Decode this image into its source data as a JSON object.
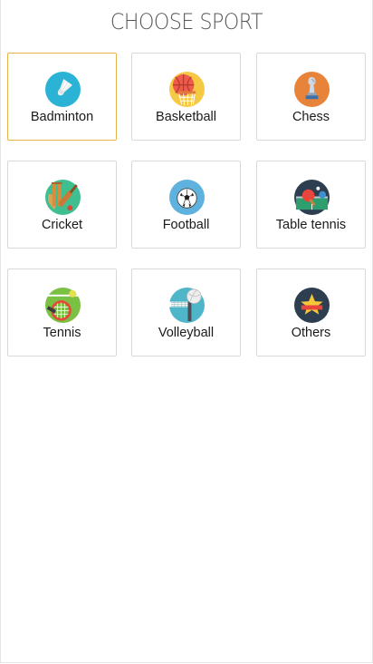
{
  "header": {
    "title": "CHOOSE SPORT"
  },
  "sports": [
    {
      "label": "Badminton",
      "icon": "shuttlecock-icon",
      "selected": true
    },
    {
      "label": "Basketball",
      "icon": "basketball-icon",
      "selected": false
    },
    {
      "label": "Chess",
      "icon": "chess-piece-icon",
      "selected": false
    },
    {
      "label": "Cricket",
      "icon": "cricket-bat-icon",
      "selected": false
    },
    {
      "label": "Football",
      "icon": "soccer-ball-icon",
      "selected": false
    },
    {
      "label": "Table tennis",
      "icon": "ping-pong-icon",
      "selected": false
    },
    {
      "label": "Tennis",
      "icon": "tennis-racket-icon",
      "selected": false
    },
    {
      "label": "Volleyball",
      "icon": "volleyball-icon",
      "selected": false
    },
    {
      "label": "Others",
      "icon": "star-icon",
      "selected": false
    }
  ],
  "colors": {
    "selected_border": "#e8b24a",
    "tile_border": "#d9d9d9",
    "title": "#555555"
  }
}
